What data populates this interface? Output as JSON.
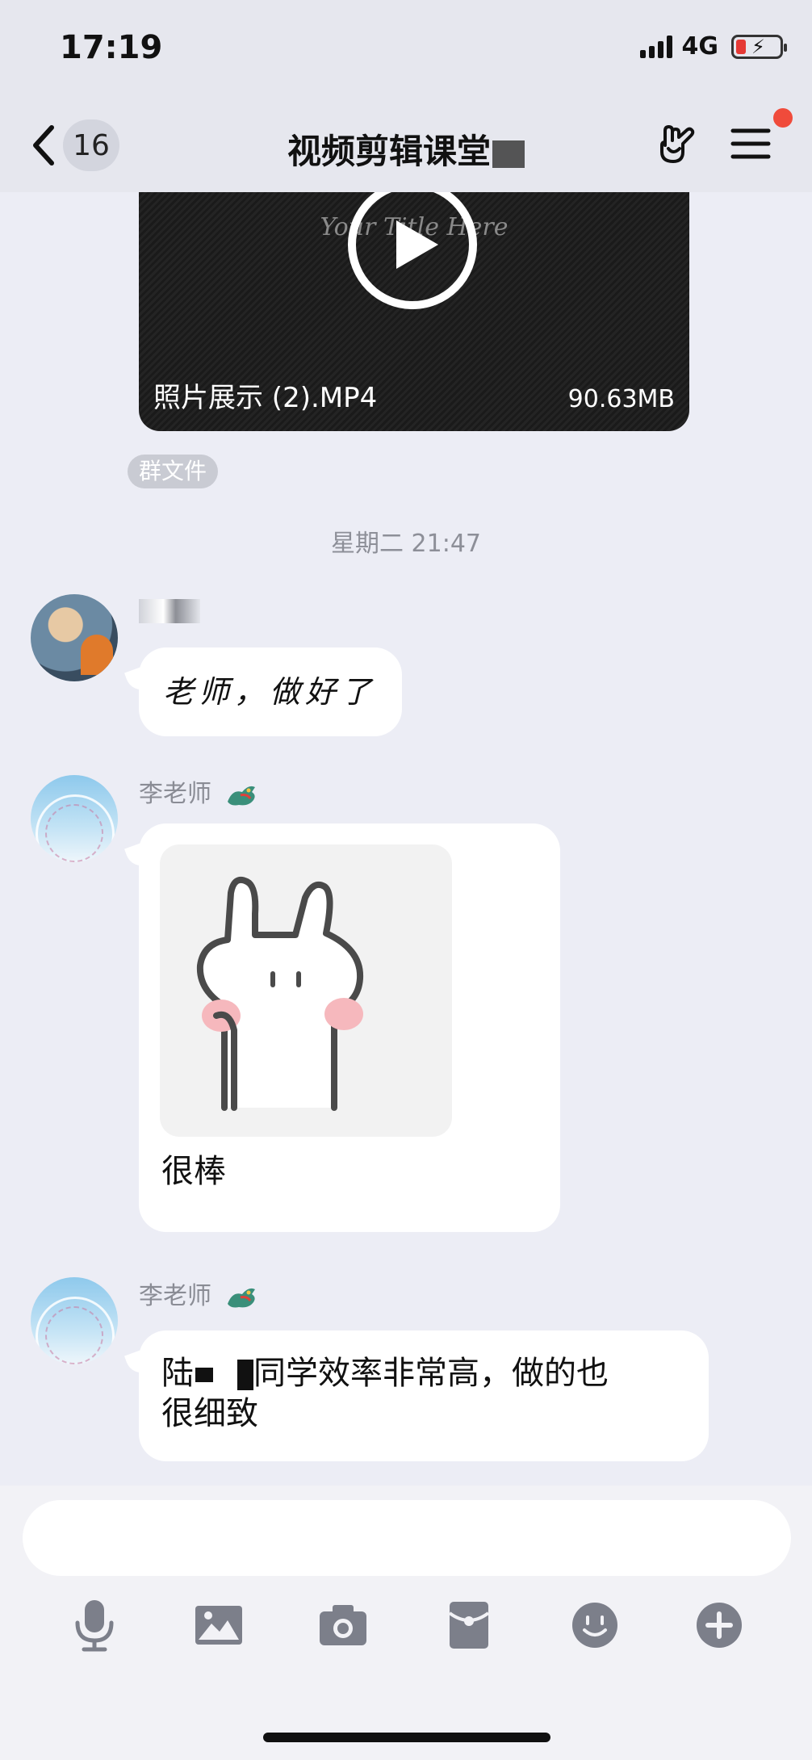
{
  "status_bar": {
    "time": "17:19",
    "network": "4G"
  },
  "nav": {
    "unread_count": "16",
    "title": "视频剪辑课堂"
  },
  "messages": {
    "video": {
      "watermark": "Your Title Here",
      "file_name": "照片展示 (2).MP4",
      "file_size": "90.63MB",
      "tag": "群文件"
    },
    "timestamp": "星期二 21:47",
    "student_reply": {
      "text": "老师，做好了"
    },
    "teacher_sticker": {
      "sender": "李老师",
      "caption": "很棒"
    },
    "teacher_praise": {
      "sender": "李老师",
      "line1_start": "陆",
      "line1_end": "同学效率非常高，做的也",
      "line2": "很细致"
    }
  },
  "colors": {
    "accent_red": "#f04b3b",
    "background": "#ecedf5",
    "bubble": "#ffffff"
  },
  "icons": [
    "back-chevron-icon",
    "hand-gesture-icon",
    "menu-icon",
    "play-icon",
    "microphone-icon",
    "image-icon",
    "camera-icon",
    "red-packet-icon",
    "emoji-icon",
    "plus-icon"
  ]
}
